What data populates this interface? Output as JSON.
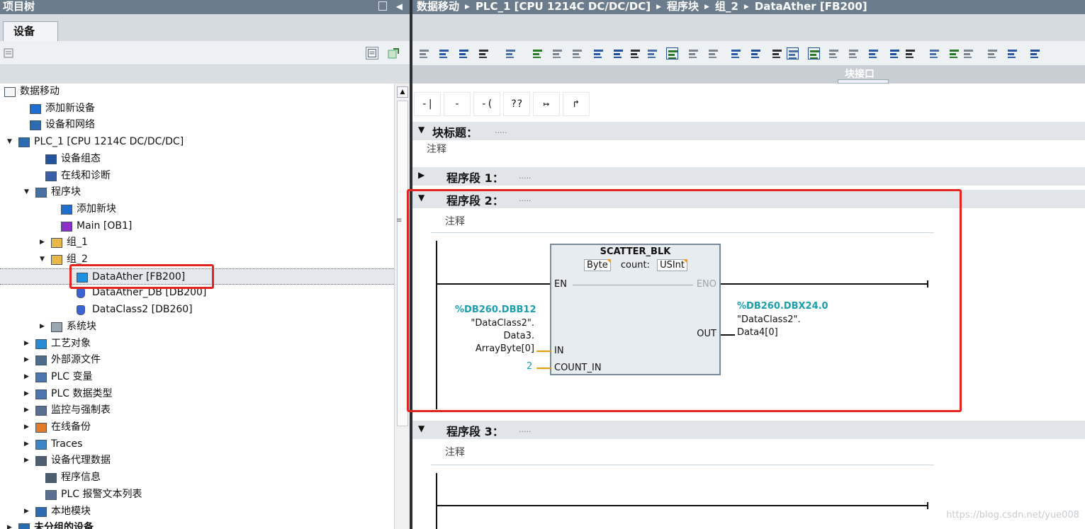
{
  "left_panel": {
    "title": "项目树",
    "tab": "设备",
    "tree": [
      {
        "label": "数据移动",
        "icon": "project-icon",
        "expander": "▼"
      },
      {
        "label": "添加新设备",
        "icon": "add-device-icon",
        "expander": ""
      },
      {
        "label": "设备和网络",
        "icon": "network-icon",
        "expander": ""
      },
      {
        "label": "PLC_1 [CPU 1214C DC/DC/DC]",
        "icon": "plc-icon",
        "expander": "▼"
      },
      {
        "label": "设备组态",
        "icon": "device-config-icon",
        "expander": ""
      },
      {
        "label": "在线和诊断",
        "icon": "diagnostics-icon",
        "expander": ""
      },
      {
        "label": "程序块",
        "icon": "program-blocks-icon",
        "expander": "▼"
      },
      {
        "label": "添加新块",
        "icon": "add-block-icon",
        "expander": ""
      },
      {
        "label": "Main [OB1]",
        "icon": "ob-icon",
        "expander": ""
      },
      {
        "label": "组_1",
        "icon": "group-folder-icon",
        "expander": "▶"
      },
      {
        "label": "组_2",
        "icon": "group-folder-icon",
        "expander": "▼"
      },
      {
        "label": "DataAther [FB200]",
        "icon": "fb-icon",
        "expander": ""
      },
      {
        "label": "DataAther_DB [DB200]",
        "icon": "db-icon",
        "expander": ""
      },
      {
        "label": "DataClass2 [DB260]",
        "icon": "db-icon",
        "expander": ""
      },
      {
        "label": "系统块",
        "icon": "system-blocks-icon",
        "expander": "▶"
      },
      {
        "label": "工艺对象",
        "icon": "technology-objects-icon",
        "expander": "▶"
      },
      {
        "label": "外部源文件",
        "icon": "external-sources-icon",
        "expander": "▶"
      },
      {
        "label": "PLC 变量",
        "icon": "plc-tags-icon",
        "expander": "▶"
      },
      {
        "label": "PLC 数据类型",
        "icon": "plc-datatypes-icon",
        "expander": "▶"
      },
      {
        "label": "监控与强制表",
        "icon": "watch-tables-icon",
        "expander": "▶"
      },
      {
        "label": "在线备份",
        "icon": "online-backup-icon",
        "expander": "▶"
      },
      {
        "label": "Traces",
        "icon": "traces-icon",
        "expander": "▶"
      },
      {
        "label": "设备代理数据",
        "icon": "proxy-data-icon",
        "expander": "▶"
      },
      {
        "label": "程序信息",
        "icon": "program-info-icon",
        "expander": ""
      },
      {
        "label": "PLC 报警文本列表",
        "icon": "alarm-text-icon",
        "expander": ""
      },
      {
        "label": "本地模块",
        "icon": "local-modules-icon",
        "expander": "▶"
      },
      {
        "label": "未分组的设备",
        "icon": "ungrouped-devices-icon",
        "expander": "▶"
      }
    ]
  },
  "breadcrumb": [
    "数据移动",
    "PLC_1 [CPU 1214C DC/DC/DC]",
    "程序块",
    "组_2",
    "DataAther [FB200]"
  ],
  "editor": {
    "interface_label": "块接口",
    "ladder_tools": [
      "-| |-",
      "-|/|-",
      "-( )-",
      "??",
      "↦",
      "↱"
    ],
    "block_title": {
      "label": "块标题：",
      "dots": ".....",
      "comment": "注释"
    },
    "networks": [
      {
        "label": "程序段 1：",
        "dots": ".....",
        "expander": "▶"
      },
      {
        "label": "程序段 2：",
        "dots": ".....",
        "expander": "▼",
        "comment": "注释"
      },
      {
        "label": "程序段 3：",
        "dots": ".....",
        "expander": "▼",
        "comment": "注释"
      }
    ],
    "function_block": {
      "name": "SCATTER_BLK",
      "type1": "Byte",
      "count_label": "count:",
      "type2": "USInt",
      "pins": {
        "en": "EN",
        "eno": "ENO",
        "in": "IN",
        "count_in": "COUNT_IN",
        "out": "OUT"
      }
    },
    "in_operand": {
      "address": "%DB260.DBB12",
      "line1": "\"DataClass2\".",
      "line2": "Data3.",
      "line3": "ArrayByte[0]"
    },
    "count_in_value": "2",
    "out_operand": {
      "address": "%DB260.DBX24.0",
      "line1": "\"DataClass2\".",
      "line2": "Data4[0]"
    }
  },
  "watermark": "https://blog.csdn.net/yue008",
  "colors": {
    "header_bar": "#6b7d8c",
    "highlight_red": "#e5231f",
    "operand_teal": "#1a9fae",
    "eno_gray": "#9aa3ab"
  }
}
